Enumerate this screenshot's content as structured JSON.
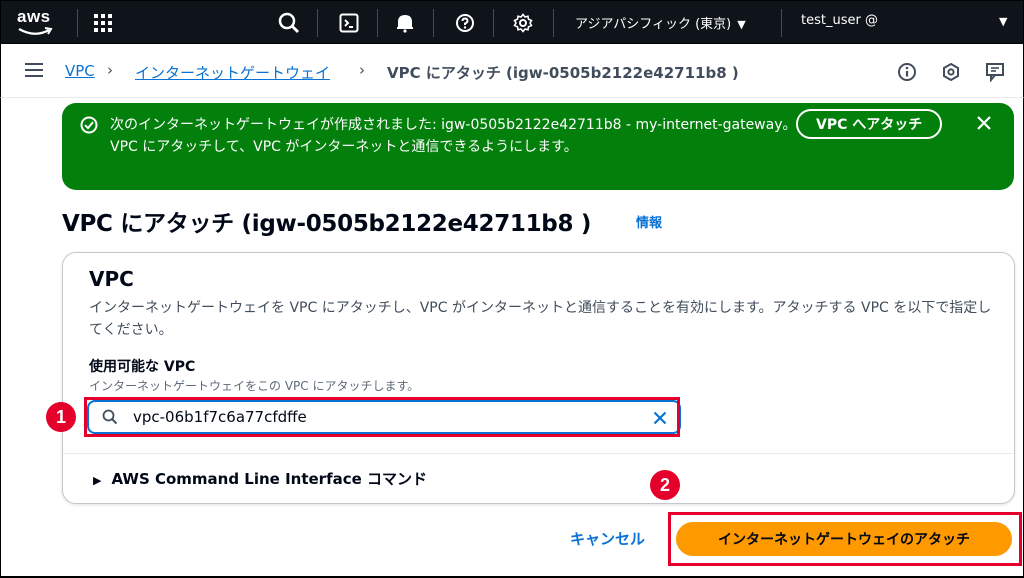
{
  "topbar": {
    "logo_text": "aws",
    "region": "アジアパシフィック (東京)",
    "user": "test_user @"
  },
  "breadcrumb": {
    "items": [
      "VPC",
      "インターネットゲートウェイ",
      "VPC にアタッチ (igw-0505b2122e42711b8 )"
    ]
  },
  "flash": {
    "message": "次のインターネットゲートウェイが作成されました: igw-0505b2122e42711b8 - my-internet-gateway。VPC にアタッチして、VPC がインターネットと通信できるようにします。",
    "action_label": "VPC へアタッチ",
    "color": "#037f0c"
  },
  "page": {
    "title": "VPC にアタッチ (igw-0505b2122e42711b8 )",
    "info_label": "情報"
  },
  "vpc_section": {
    "title": "VPC",
    "description": "インターネットゲートウェイを VPC にアタッチし、VPC がインターネットと通信することを有効にします。アタッチする VPC を以下で指定してください。",
    "field_label": "使用可能な VPC",
    "field_description": "インターネットゲートウェイをこの VPC にアタッチします。",
    "field_value": "vpc-06b1f7c6a77cfdffe",
    "cli_expander": "AWS Command Line Interface コマンド"
  },
  "actions": {
    "cancel_label": "キャンセル",
    "submit_label": "インターネットゲートウェイのアタッチ",
    "submit_color": "#ff9900"
  },
  "annotations": {
    "step1": "1",
    "step2": "2",
    "color": "#e4002b"
  }
}
